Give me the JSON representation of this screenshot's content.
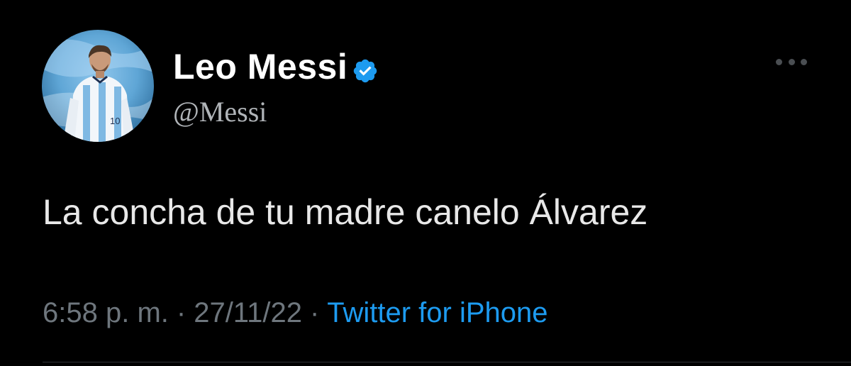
{
  "author": {
    "display_name": "Leo Messi",
    "handle": "@Messi",
    "verified": true,
    "verified_badge_color": "#1d9bf0",
    "avatar_icon": "profile-photo"
  },
  "tweet": {
    "text": "La concha de tu madre canelo Álvarez"
  },
  "meta": {
    "time": "6:58 p. m.",
    "separator": "·",
    "date": "27/11/22",
    "source": "Twitter for iPhone"
  },
  "menu": {
    "icon": "more-horizontal-icon"
  },
  "colors": {
    "background": "#000000",
    "name": "#ffffff",
    "handle": "#b0b4b8",
    "text": "#e8e8e8",
    "meta": "#6e767d",
    "link": "#1d9bf0"
  }
}
